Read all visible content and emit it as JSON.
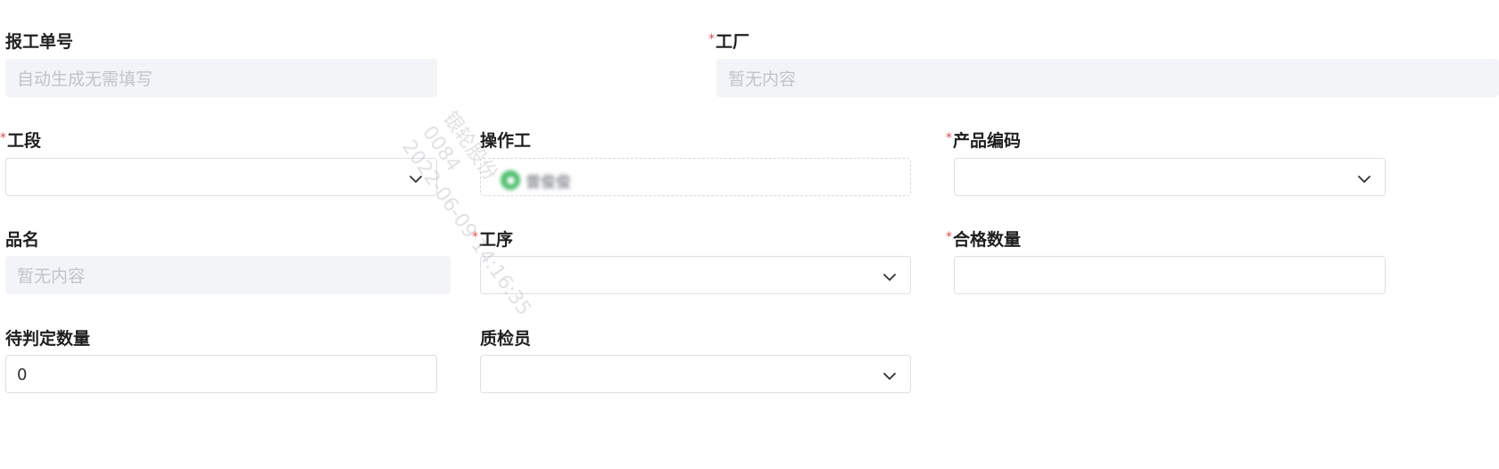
{
  "form": {
    "report_no": {
      "label": "报工单号",
      "placeholder": "自动生成无需填写",
      "required": false
    },
    "factory": {
      "label": "工厂",
      "placeholder": "暂无内容",
      "required": true
    },
    "section": {
      "label": "工段",
      "value": "",
      "required": true
    },
    "operator": {
      "label": "操作工",
      "value": "曾俊俊",
      "required": false
    },
    "product_code": {
      "label": "产品编码",
      "value": "",
      "required": true
    },
    "product_name": {
      "label": "品名",
      "placeholder": "暂无内容",
      "required": false
    },
    "process": {
      "label": "工序",
      "value": "",
      "required": true
    },
    "qualified_qty": {
      "label": "合格数量",
      "value": "",
      "required": true
    },
    "pending_qty": {
      "label": "待判定数量",
      "value": "0",
      "required": false
    },
    "inspector": {
      "label": "质检员",
      "value": "",
      "required": false
    }
  },
  "required_mark": "*",
  "watermark": {
    "line1": "银轮股份",
    "line2": "0084",
    "line3": "2022-06-09 14:16:35"
  },
  "icons": {
    "dropdown": "chevron-down-icon",
    "user": "user-avatar-icon"
  },
  "colors": {
    "required": "#e34d4d",
    "disabled_bg": "#f3f4f7",
    "border": "#dcdfe6",
    "avatar": "#4cbd6b"
  }
}
